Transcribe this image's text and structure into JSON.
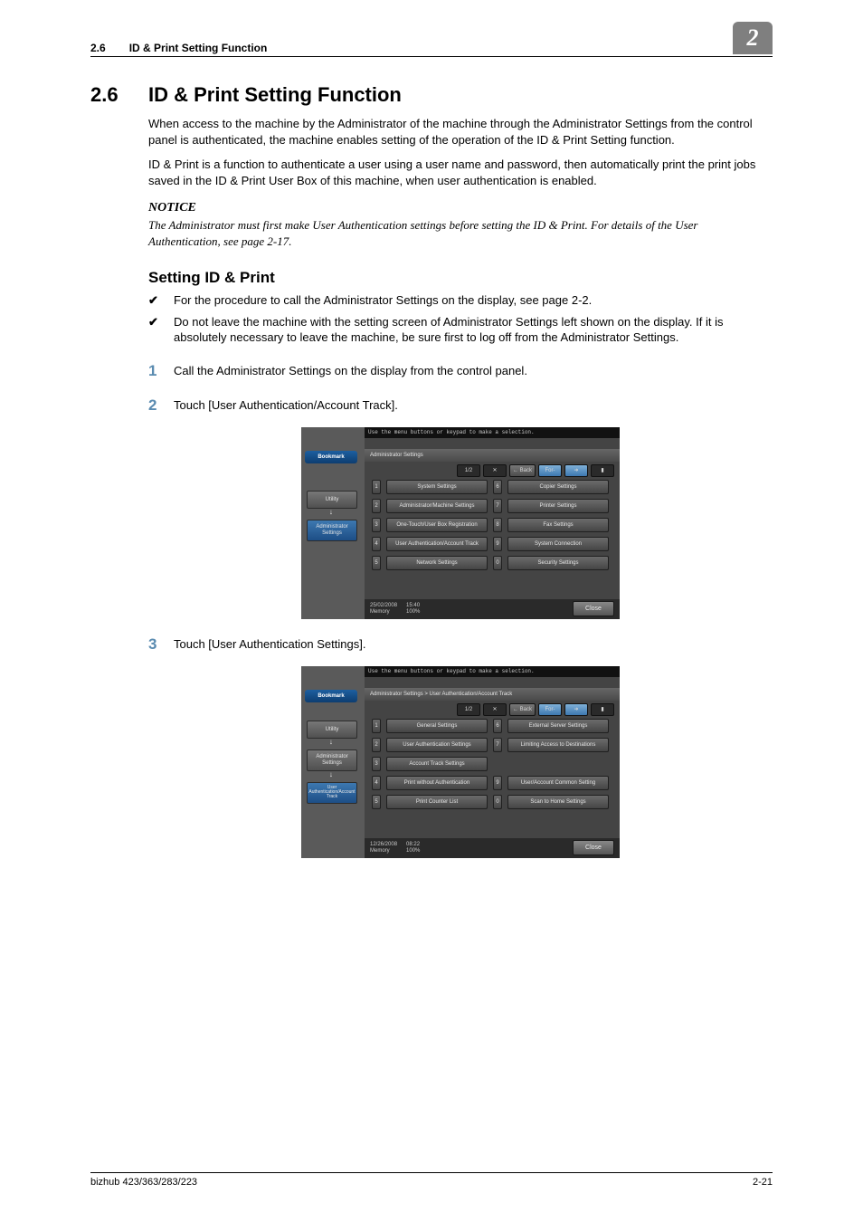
{
  "header": {
    "num": "2.6",
    "title": "ID & Print Setting Function",
    "chapnum": "2"
  },
  "footer": {
    "left": "bizhub 423/363/283/223",
    "right": "2-21"
  },
  "section": {
    "num": "2.6",
    "title": "ID & Print Setting Function"
  },
  "body": {
    "p1": "When access to the machine by the Administrator of the machine through the Administrator Settings from the control panel is authenticated, the machine enables setting of the operation of the ID & Print Setting function.",
    "p2": "ID & Print is a function to authenticate a user using a user name and password, then automatically print the print jobs saved in the ID & Print User Box of this machine, when user authentication is enabled.",
    "notice_label": "NOTICE",
    "notice_body": "The Administrator must first make User Authentication settings before setting the ID & Print. For details of the User Authentication, see page 2-17.",
    "h3": "Setting ID & Print",
    "check1": "For the procedure to call the Administrator Settings on the display, see page 2-2.",
    "check2": "Do not leave the machine with the setting screen of Administrator Settings left shown on the display. If it is absolutely necessary to leave the machine, be sure first to log off from the Administrator Settings.",
    "step1": "Call the Administrator Settings on the display from the control panel.",
    "step2": "Touch [User Authentication/Account Track].",
    "step3": "Touch [User Authentication Settings]."
  },
  "screens": {
    "common": {
      "topbar": "Use the menu buttons or keypad to make a selection.",
      "bookmark": "Bookmark",
      "utility": "Utility",
      "admin": "Administrator Settings",
      "pager": {
        "page": "1/2",
        "back": "← Back",
        "fwd_pre": "For-",
        "fwd_post": "ward →"
      },
      "close": "Close",
      "memory": "Memory",
      "memval": "100%"
    },
    "s1": {
      "crumb": "Administrator Settings",
      "date": "25/02/2008",
      "time": "15:40",
      "items": [
        {
          "n": "1",
          "l": "System Settings"
        },
        {
          "n": "6",
          "l": "Copier Settings"
        },
        {
          "n": "2",
          "l": "Administrator/Machine Settings"
        },
        {
          "n": "7",
          "l": "Printer Settings"
        },
        {
          "n": "3",
          "l": "One-Touch/User Box Registration"
        },
        {
          "n": "8",
          "l": "Fax Settings"
        },
        {
          "n": "4",
          "l": "User Authentication/Account Track"
        },
        {
          "n": "9",
          "l": "System Connection"
        },
        {
          "n": "5",
          "l": "Network Settings"
        },
        {
          "n": "0",
          "l": "Security Settings"
        }
      ]
    },
    "s2": {
      "crumb": "Administrator Settings > User Authentication/Account Track",
      "side_extra": "User Authentication/Account Track",
      "date": "12/26/2008",
      "time": "08:22",
      "items": [
        {
          "n": "1",
          "l": "General Settings"
        },
        {
          "n": "6",
          "l": "External Server Settings"
        },
        {
          "n": "2",
          "l": "User Authentication Settings"
        },
        {
          "n": "7",
          "l": "Limiting Access to Destinations"
        },
        {
          "n": "3",
          "l": "Account Track Settings"
        },
        {
          "n": "",
          "l": ""
        },
        {
          "n": "4",
          "l": "Print without Authentication"
        },
        {
          "n": "9",
          "l": "User/Account Common Setting"
        },
        {
          "n": "5",
          "l": "Print Counter List"
        },
        {
          "n": "0",
          "l": "Scan to Home Settings"
        }
      ]
    }
  }
}
